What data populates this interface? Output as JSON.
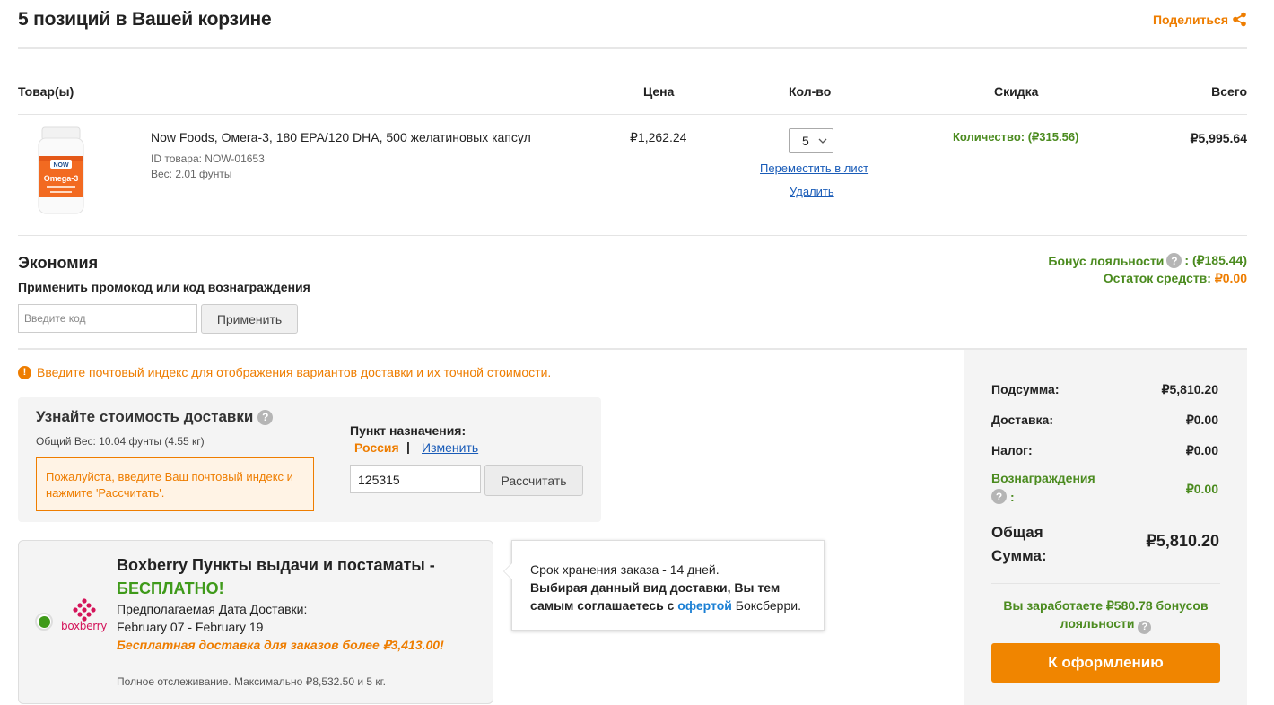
{
  "header": {
    "title": "5 позиций в Вашей корзине",
    "share_label": "Поделиться"
  },
  "table": {
    "columns": [
      "Товар(ы)",
      "Цена",
      "Кол-во",
      "Скидка",
      "Всего"
    ],
    "item": {
      "name": "Now Foods, Омега-3, 180 EPA/120 DHA, 500 желатиновых капсул",
      "id_line": "ID товара: NOW-01653",
      "weight_line": "Вес: 2.01 фунты",
      "price": "₽1,262.24",
      "quantity": "5",
      "move_to_list": "Переместить в лист",
      "delete": "Удалить",
      "discount": "Количество: (₽315.56)",
      "total": "₽5,995.64",
      "image_brand": "NOW",
      "image_label": "Omega-3"
    }
  },
  "economy": {
    "title": "Экономия",
    "promo_label": "Применить промокод или код вознаграждения",
    "promo_placeholder": "Введите код",
    "apply_button": "Применить",
    "loyalty_label": "Бонус лояльности",
    "loyalty_value": ": (₽185.44)",
    "balance_label": "Остаток средств:",
    "balance_value": "₽0.00"
  },
  "shipping": {
    "notice": "Введите почтовый индекс для отображения вариантов доставки и их точной стоимости.",
    "box_title": "Узнайте стоимость доставки",
    "total_weight": "Общий Вес: 10.04 фунты (4.55 кг)",
    "zip_warning": "Пожалуйста, введите Ваш почтовый индекс и нажмите 'Рассчитать'.",
    "destination_label": "Пункт назначения:",
    "country": "Россия",
    "separator": "|",
    "change_link": "Изменить",
    "zip_value": "125315",
    "calculate_button": "Рассчитать"
  },
  "boxberry": {
    "title": "Boxberry Пункты выдачи и постаматы -",
    "free": "БЕСПЛАТНО!",
    "eta_label": "Предполагаемая Дата Доставки:",
    "dates": "February 07 - February 19",
    "free_note": "Бесплатная доставка для заказов более ₽3,413.00!",
    "tracking": "Полное отслеживание. Максимально ₽8,532.50 и 5 кг.",
    "logo_text": "boxberry"
  },
  "tooltip": {
    "line1": "Срок хранения заказа - 14 дней.",
    "line2_a": "Выбирая данный вид доставки, Вы тем самым соглашаетесь с ",
    "offer_link": "офертой",
    "line2_b": " Боксберри."
  },
  "summary": {
    "subtotal_label": "Подсумма:",
    "subtotal_value": "₽5,810.20",
    "shipping_label": "Доставка:",
    "shipping_value": "₽0.00",
    "tax_label": "Налог:",
    "tax_value": "₽0.00",
    "rewards_label": "Вознаграждения",
    "rewards_colon": ":",
    "rewards_value": "₽0.00",
    "total_label_1": "Общая",
    "total_label_2": "Сумма:",
    "total_value": "₽5,810.20",
    "earn_text": "Вы заработаете ₽580.78 бонусов лояльности",
    "checkout_button": "К оформлению"
  },
  "colors": {
    "accent_orange": "#ee7d00",
    "discount_green": "#4b8b1f",
    "free_green": "#3f9a1a",
    "link_blue": "#1a5cb8",
    "boxberry_pink": "#d4145a"
  }
}
